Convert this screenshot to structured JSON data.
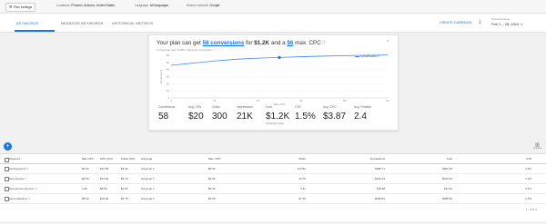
{
  "topbar": {
    "settings_label": "Plan settings",
    "locations_prefix": "Locations:",
    "locations_value": "Phoenix, Arizona, United States",
    "language_prefix": "Language:",
    "language_value": "All languages",
    "network_prefix": "Search network:",
    "network_value": "Google"
  },
  "tabs": [
    {
      "label": "Keywords",
      "active": true
    },
    {
      "label": "Negative keywords",
      "active": false
    },
    {
      "label": "Historical metrics",
      "active": false
    }
  ],
  "actions": {
    "create_campaign": "Create campaign",
    "forecast_range_label": "Forecast range",
    "forecast_range_value": "Feb 1 – 28, 2019"
  },
  "forecast": {
    "headline_pre": "Your plan can get ",
    "headline_conversions": "58 conversions",
    "headline_mid1": " for ",
    "headline_cost": "$1.2K",
    "headline_mid2": " and a ",
    "headline_cpc": "$6",
    "headline_post": " max. CPC",
    "subnote": "Conversion rate: 19.8%; Value per conversion: –",
    "legend": "Conversions",
    "metrics": [
      {
        "label": "Conversions",
        "value": "58",
        "sub": ""
      },
      {
        "label": "Avg. CPA",
        "value": "$20",
        "sub": ""
      },
      {
        "label": "Clicks",
        "value": "300",
        "sub": ""
      },
      {
        "label": "Impressions",
        "value": "21K",
        "sub": ""
      },
      {
        "label": "Cost",
        "value": "$1.2K",
        "sub": "Conversion value"
      },
      {
        "label": "CTR",
        "value": "1.5%",
        "sub": ""
      },
      {
        "label": "Avg. CPC",
        "value": "$3.87",
        "sub": ""
      },
      {
        "label": "Avg. Position",
        "value": "2.4",
        "sub": ""
      }
    ]
  },
  "chart_data": {
    "type": "line",
    "x": [
      0,
      6,
      12,
      18,
      24,
      30,
      36,
      42,
      48,
      54,
      60
    ],
    "series": [
      {
        "name": "Conversions",
        "values": [
          46,
          49,
          52,
          54.5,
          56,
          57,
          58,
          58.8,
          59.5,
          60,
          60.5
        ]
      }
    ],
    "marker": {
      "x": 30,
      "y": 57
    },
    "xticks": [
      "0",
      "12",
      "24",
      "36",
      "48",
      "60"
    ],
    "yticks": [
      "0",
      "10",
      "20",
      "30",
      "40",
      "50",
      "60"
    ],
    "xlim": [
      0,
      60
    ],
    "ylim": [
      0,
      60
    ],
    "xlabel": "Max. CPC",
    "ylabel": "Conversions"
  },
  "table": {
    "columns": [
      "Keyword",
      "Max CPC",
      "CPC (CO)",
      "Clicks (CO)",
      "Ad group",
      "Max. CPC",
      "Clicks",
      "Impressions",
      "Cost",
      "CTR"
    ],
    "rows": [
      [
        "best keyword",
        "$2.00",
        "$12.00",
        "$3.20",
        "Ad group 1",
        "$6.00",
        "124.84",
        "$385.71",
        "$902.15",
        "1.5%"
      ],
      [
        "best service",
        "$0.50",
        "$14.00",
        "$2.10",
        "Ad group 1",
        "$6.00",
        "62.79",
        "$216.24",
        "$313.46",
        "1.1%"
      ],
      [
        "best service phoenix",
        "1.82",
        "$8.56",
        "$1.96",
        "Ad group 1",
        "$6.00",
        "4.11",
        "108.88",
        "$11.81",
        "3.7%"
      ],
      [
        "best marketing",
        "$8.00",
        "$16.00",
        "$2.75",
        "Ad group 1",
        "$6.00",
        "87.16",
        "$396.81",
        "$288.35",
        "1.5%"
      ]
    ],
    "pager": "1 – 4 of 4"
  },
  "controls": {
    "fab": "+",
    "columns_label": "Columns"
  }
}
